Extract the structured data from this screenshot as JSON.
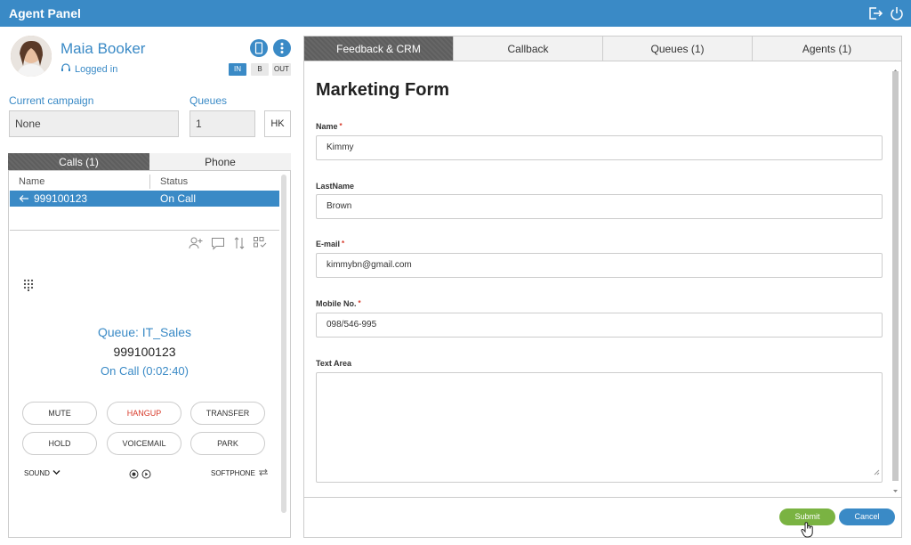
{
  "app": {
    "title": "Agent Panel"
  },
  "agent": {
    "name": "Maia Booker",
    "status": "Logged in",
    "states": [
      "IN",
      "B",
      "OUT"
    ]
  },
  "campaign": {
    "label": "Current campaign",
    "value": "None"
  },
  "queues": {
    "label": "Queues",
    "value": "1",
    "hk": "HK"
  },
  "left_tabs": [
    "Calls (1)",
    "Phone"
  ],
  "calls_table": {
    "headers": [
      "Name",
      "Status"
    ],
    "rows": [
      {
        "number": "999100123",
        "status": "On Call"
      }
    ]
  },
  "call_info": {
    "queue": "Queue: IT_Sales",
    "number": "999100123",
    "status": "On Call (0:02:40)"
  },
  "controls": [
    "MUTE",
    "HANGUP",
    "TRANSFER",
    "HOLD",
    "VOICEMAIL",
    "PARK"
  ],
  "bottom_controls": {
    "sound": "SOUND",
    "softphone": "SOFTPHONE"
  },
  "right_tabs": [
    "Feedback & CRM",
    "Callback",
    "Queues (1)",
    "Agents (1)"
  ],
  "form": {
    "title": "Marketing Form",
    "fields": [
      {
        "label": "Name",
        "value": "Kimmy",
        "required": true
      },
      {
        "label": "LastName",
        "value": "Brown",
        "required": false
      },
      {
        "label": "E-mail",
        "value": "kimmybn@gmail.com",
        "required": true
      },
      {
        "label": "Mobile No.",
        "value": "098/546-995",
        "required": true
      }
    ],
    "textarea_label": "Text Area",
    "submit": "Submit",
    "cancel": "Cancel"
  },
  "colors": {
    "accent": "#3a8ac6",
    "submit": "#7ab342",
    "danger": "#d73a2a"
  }
}
